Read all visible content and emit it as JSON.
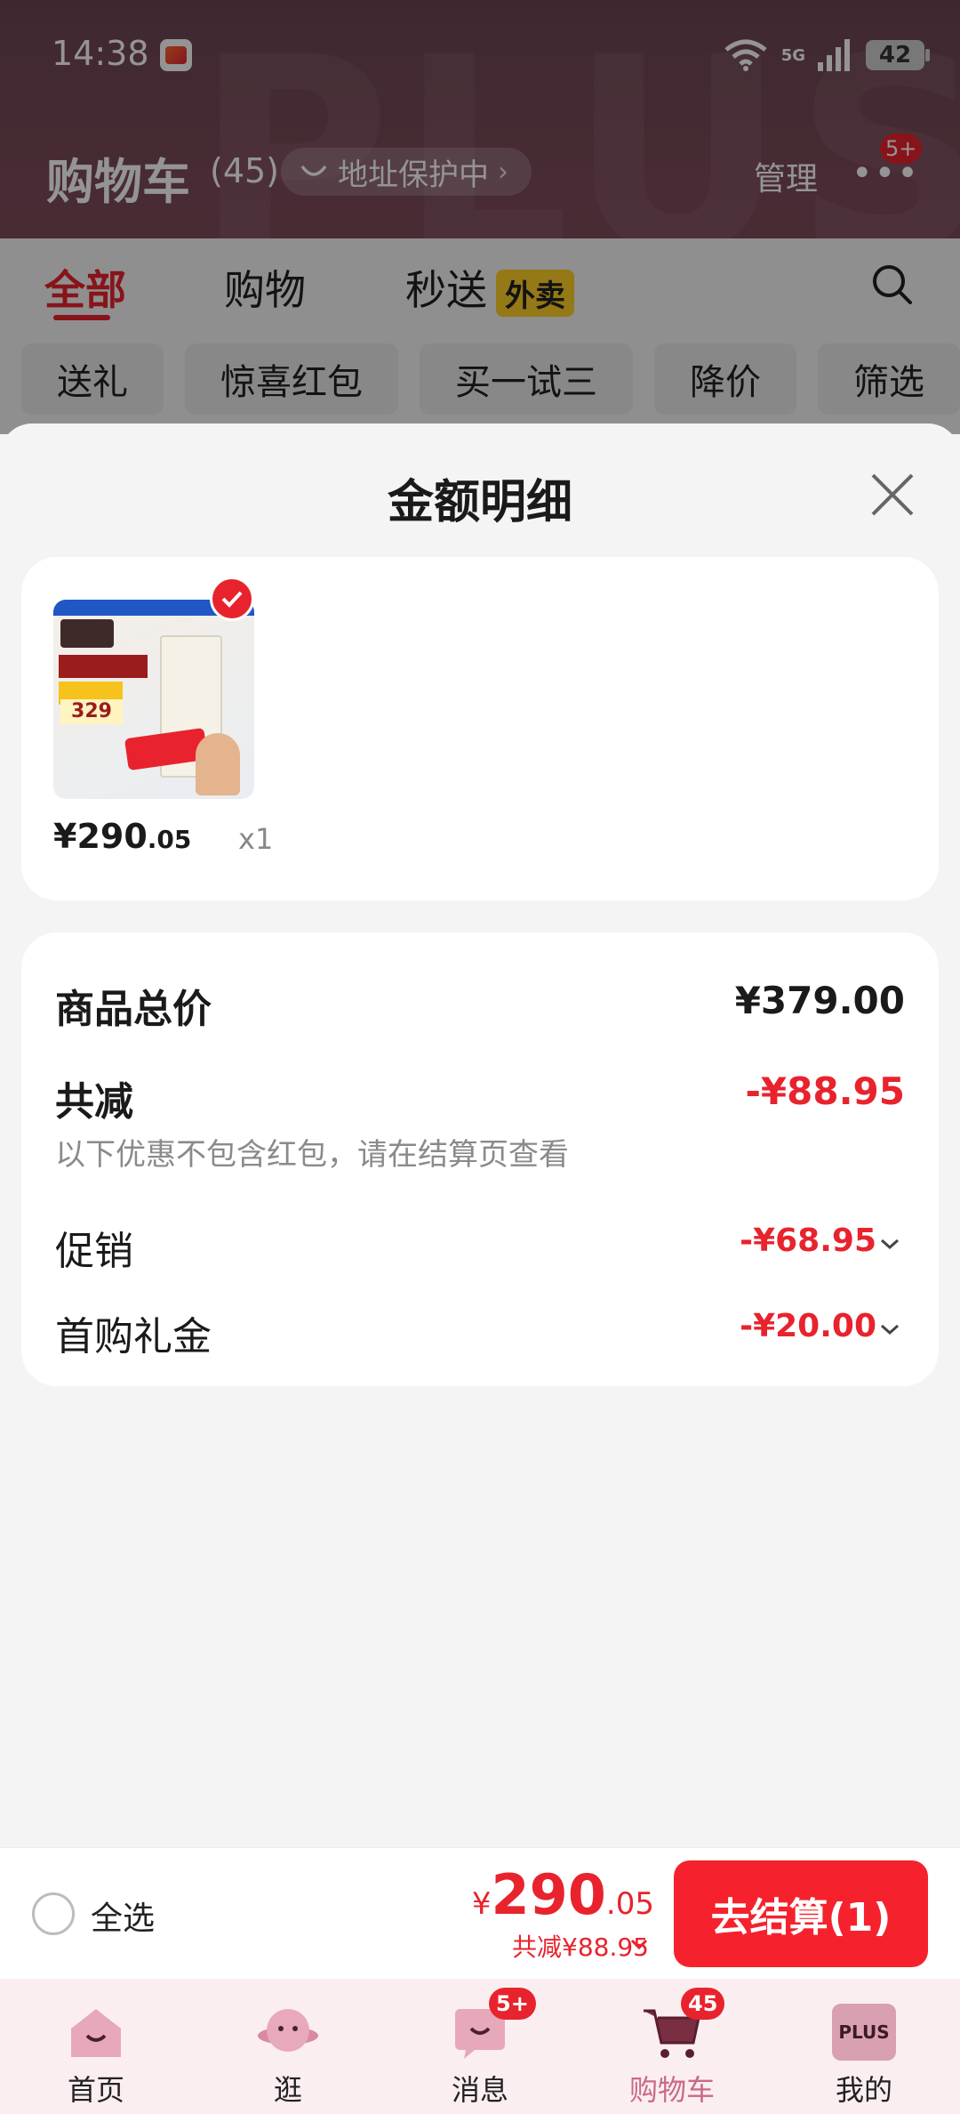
{
  "status_bar": {
    "time": "14:38",
    "network": "5G",
    "battery": "42"
  },
  "header": {
    "title": "购物车",
    "count": "(45)",
    "address_pill": "地址保护中",
    "manage": "管理",
    "more_badge": "5+"
  },
  "tabs": {
    "all": "全部",
    "shopping": "购物",
    "express": "秒送",
    "express_tag": "外卖"
  },
  "chips": [
    "送礼",
    "惊喜红包",
    "买一试三",
    "降价",
    "筛选"
  ],
  "sheet": {
    "title": "金额明细",
    "product": {
      "price_int": "¥290",
      "price_dec": ".05",
      "qty": "x1"
    },
    "summary": {
      "total_label": "商品总价",
      "total_value": "¥379.00",
      "discount_label": "共减",
      "discount_value": "-¥88.95",
      "discount_note": "以下优惠不包含红包，请在结算页查看",
      "promo_label": "促销",
      "promo_value": "-¥68.95",
      "gift_label": "首购礼金",
      "gift_value": "-¥20.00"
    }
  },
  "checkout": {
    "select_all": "全选",
    "yen": "¥",
    "total_int": "290",
    "total_dec": ".05",
    "saved": "共减¥88.95",
    "button": "去结算(1)"
  },
  "nav": {
    "items": [
      {
        "label": "首页"
      },
      {
        "label": "逛"
      },
      {
        "label": "消息",
        "badge": "5+"
      },
      {
        "label": "购物车",
        "badge": "45"
      },
      {
        "label": "我的",
        "icon_text": "PLUS"
      }
    ]
  },
  "colors": {
    "accent": "#e8232d",
    "nav_active": "#c96a86",
    "waimai_tag": "#ffd027"
  }
}
